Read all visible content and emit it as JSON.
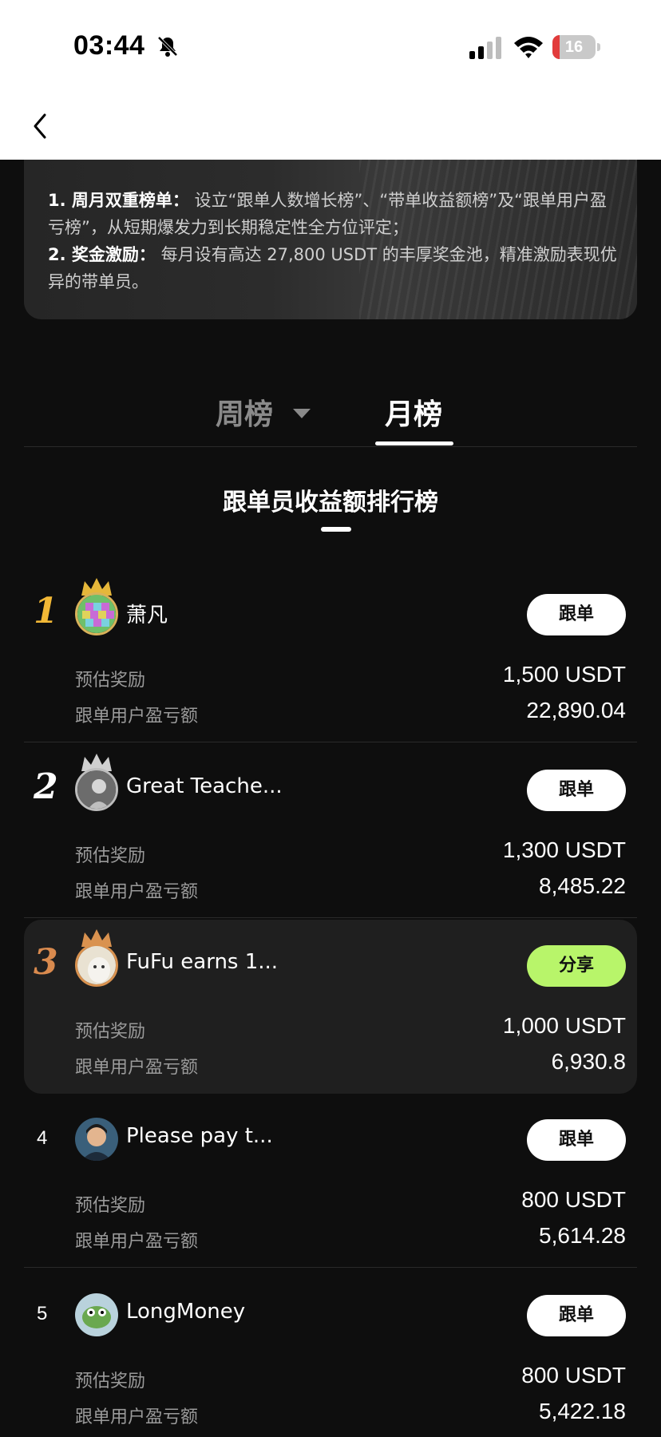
{
  "status_bar": {
    "time": "03:44",
    "battery": "16",
    "battery_level": 0.16
  },
  "banner": {
    "item1_title": "1. 周月双重榜单：",
    "item1_text": "设立“跟单人数增长榜”、“带单收益额榜”及“跟单用户盈亏榜”，从短期爆发力到长期稳定性全方位评定；",
    "item2_title": "2. 奖金激励：",
    "item2_text": "每月设有高达 27,800 USDT 的丰厚奖金池，精准激励表现优异的带单员。"
  },
  "tabs": {
    "week": "周榜",
    "month": "月榜"
  },
  "section_title": "跟单员收益额排行榜",
  "labels": {
    "reward": "预估奖励",
    "pnl": "跟单用户盈亏额"
  },
  "rows": [
    {
      "rank": "1",
      "name": "萧凡",
      "button": "跟单",
      "reward": "1,500 USDT",
      "pnl": "22,890.04"
    },
    {
      "rank": "2",
      "name": "Great Teache...",
      "button": "跟单",
      "reward": "1,300 USDT",
      "pnl": "8,485.22"
    },
    {
      "rank": "3",
      "name": "FuFu earns 1...",
      "button": "分享",
      "reward": "1,000 USDT",
      "pnl": "6,930.8"
    },
    {
      "rank": "4",
      "name": "Please pay t...",
      "button": "跟单",
      "reward": "800 USDT",
      "pnl": "5,614.28"
    },
    {
      "rank": "5",
      "name": "LongMoney",
      "button": "跟单",
      "reward": "800 USDT",
      "pnl": "5,422.18"
    }
  ],
  "colors": {
    "gold": "#f2b836",
    "silver": "#ffffff",
    "bronze": "#d98a4e",
    "share_button": "#b8f56a"
  }
}
